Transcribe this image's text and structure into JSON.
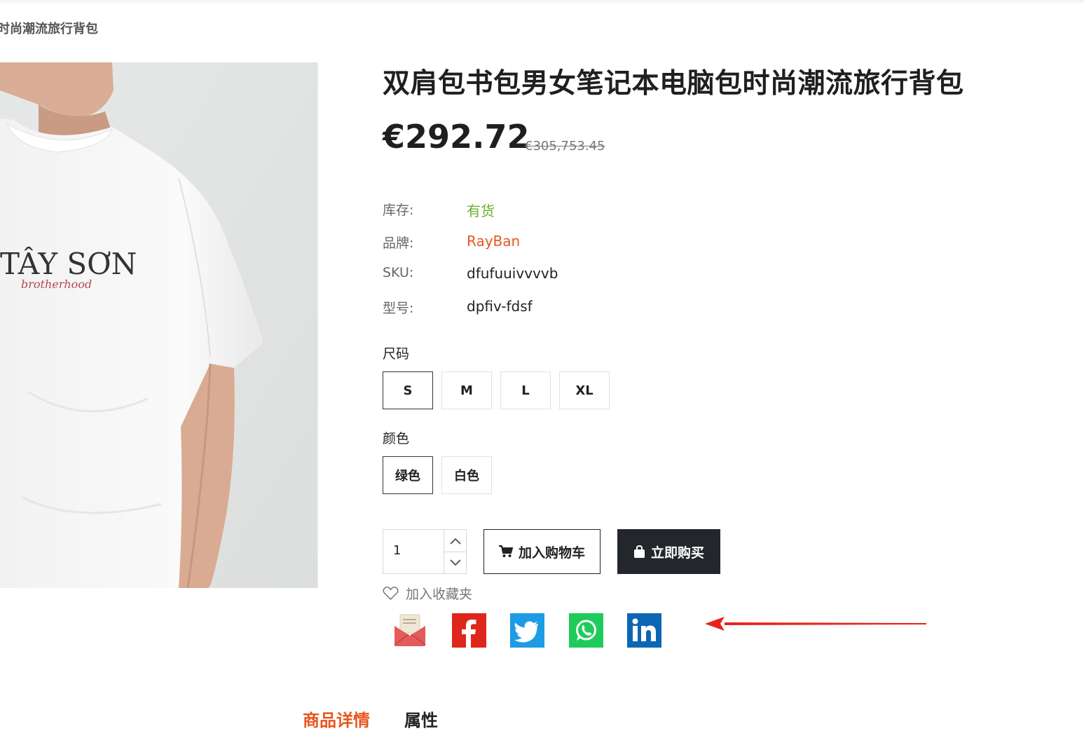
{
  "breadcrumb": {
    "current": "时尚潮流旅行背包"
  },
  "product": {
    "image_alt": "white t-shirt",
    "shirt_print_main": "TÂY SƠN",
    "shirt_print_sub": "brotherhood",
    "title": "双肩包书包男女笔记本电脑包时尚潮流旅行背包",
    "price": "€292.72",
    "old_price": "€305,753.45"
  },
  "specs": [
    {
      "label": "库存:",
      "value": "有货",
      "color": "#6ab130"
    },
    {
      "label": "品牌:",
      "value": "RayBan",
      "color": "#e8561f"
    },
    {
      "label": "SKU:",
      "value": "dfufuuivvvvb",
      "color": "#222222"
    },
    {
      "label": "型号:",
      "value": "dpfiv-fdsf",
      "color": "#222222"
    }
  ],
  "size": {
    "title": "尺码",
    "options": [
      "S",
      "M",
      "L",
      "XL"
    ],
    "selected": "S"
  },
  "color": {
    "title": "颜色",
    "options": [
      "绿色",
      "白色"
    ],
    "selected": "绿色"
  },
  "quantity": {
    "value": "1"
  },
  "buttons": {
    "add_to_cart": "加入购物车",
    "buy_now": "立即购买"
  },
  "wishlist": {
    "label": "加入收藏夹"
  },
  "share": [
    {
      "name": "email",
      "icon": "email-envelope-icon",
      "color": "#e45b5b"
    },
    {
      "name": "facebook",
      "icon": "facebook-icon",
      "color": "#e0261b"
    },
    {
      "name": "twitter",
      "icon": "twitter-icon",
      "color": "#1d9be4"
    },
    {
      "name": "whatsapp",
      "icon": "whatsapp-icon",
      "color": "#1fcb5b"
    },
    {
      "name": "linkedin",
      "icon": "linkedin-icon",
      "color": "#0c66b3"
    }
  ],
  "tabs": [
    {
      "label": "商品详情",
      "active": true
    },
    {
      "label": "属性",
      "active": false
    }
  ],
  "annotation": {
    "arrow_color": "#e8231b"
  }
}
